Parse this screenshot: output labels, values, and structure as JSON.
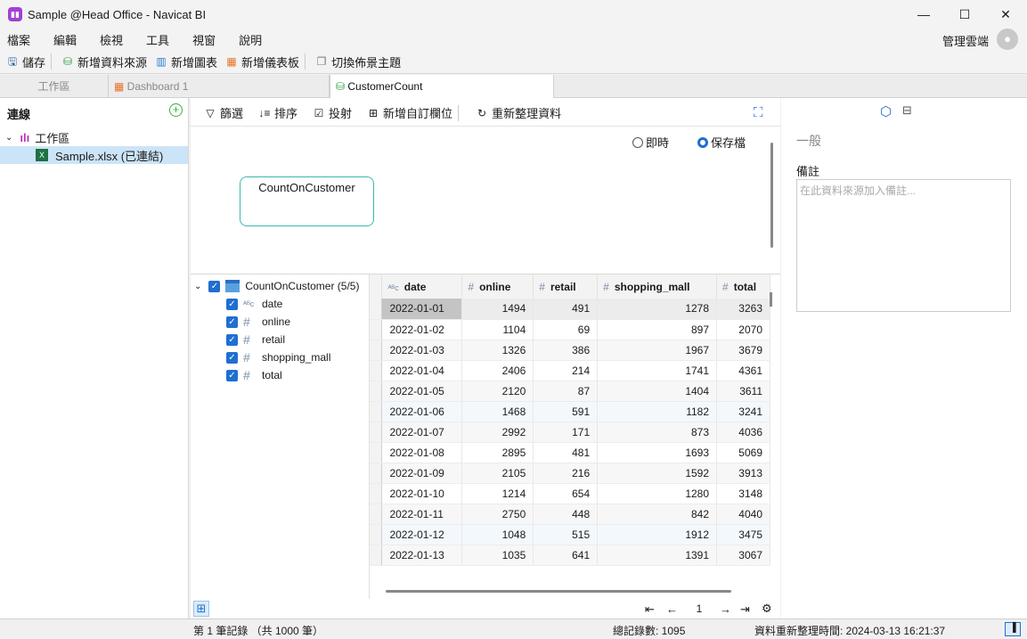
{
  "window": {
    "title": "Sample @Head Office - Navicat BI",
    "minimize": "—",
    "maximize": "☐",
    "close": "✕"
  },
  "menu": [
    "檔案",
    "編輯",
    "檢視",
    "工具",
    "視窗",
    "說明"
  ],
  "account": "管理雲端",
  "toolbar": {
    "save": "儲存",
    "new_source": "新增資料來源",
    "new_chart": "新增圖表",
    "new_dashboard": "新增儀表板",
    "switch_theme": "切換佈景主題"
  },
  "tabs": [
    "工作區",
    "Dashboard 1",
    "CustomerCount"
  ],
  "left": {
    "title": "連線",
    "workspace": "工作區",
    "file": "Sample.xlsx (已連結)"
  },
  "center_toolbar": {
    "filter": "篩選",
    "sort": "排序",
    "project": "投射",
    "add_field": "新增自訂欄位",
    "refresh": "重新整理資料"
  },
  "mode": {
    "live": "即時",
    "saved": "保存檔",
    "selected": "saved"
  },
  "node": "CountOnCustomer",
  "fields": {
    "table": "CountOnCustomer (5/5)",
    "items": [
      {
        "type": "abc",
        "name": "date"
      },
      {
        "type": "#",
        "name": "online"
      },
      {
        "type": "#",
        "name": "retail"
      },
      {
        "type": "#",
        "name": "shopping_mall"
      },
      {
        "type": "#",
        "name": "total"
      }
    ]
  },
  "grid": {
    "columns": [
      "date",
      "online",
      "retail",
      "shopping_mall",
      "total"
    ],
    "rows": [
      [
        "2022-01-01",
        "1494",
        "491",
        "1278",
        "3263"
      ],
      [
        "2022-01-02",
        "1104",
        "69",
        "897",
        "2070"
      ],
      [
        "2022-01-03",
        "1326",
        "386",
        "1967",
        "3679"
      ],
      [
        "2022-01-04",
        "2406",
        "214",
        "1741",
        "4361"
      ],
      [
        "2022-01-05",
        "2120",
        "87",
        "1404",
        "3611"
      ],
      [
        "2022-01-06",
        "1468",
        "591",
        "1182",
        "3241"
      ],
      [
        "2022-01-07",
        "2992",
        "171",
        "873",
        "4036"
      ],
      [
        "2022-01-08",
        "2895",
        "481",
        "1693",
        "5069"
      ],
      [
        "2022-01-09",
        "2105",
        "216",
        "1592",
        "3913"
      ],
      [
        "2022-01-10",
        "1214",
        "654",
        "1280",
        "3148"
      ],
      [
        "2022-01-11",
        "2750",
        "448",
        "842",
        "4040"
      ],
      [
        "2022-01-12",
        "1048",
        "515",
        "1912",
        "3475"
      ],
      [
        "2022-01-13",
        "1035",
        "641",
        "1391",
        "3067"
      ]
    ]
  },
  "pager": {
    "page": "1"
  },
  "right": {
    "section": "一般",
    "notes_label": "備註",
    "notes_placeholder": "在此資料來源加入備註..."
  },
  "status": {
    "record": "第 1 筆記錄 （共 1000 筆）",
    "total": "總記錄數: 1095",
    "refreshed": "資料重新整理時間: 2024-03-13 16:21:37"
  },
  "colors": {
    "accent": "#1f6fd1",
    "node_border": "#3bb8b0"
  }
}
